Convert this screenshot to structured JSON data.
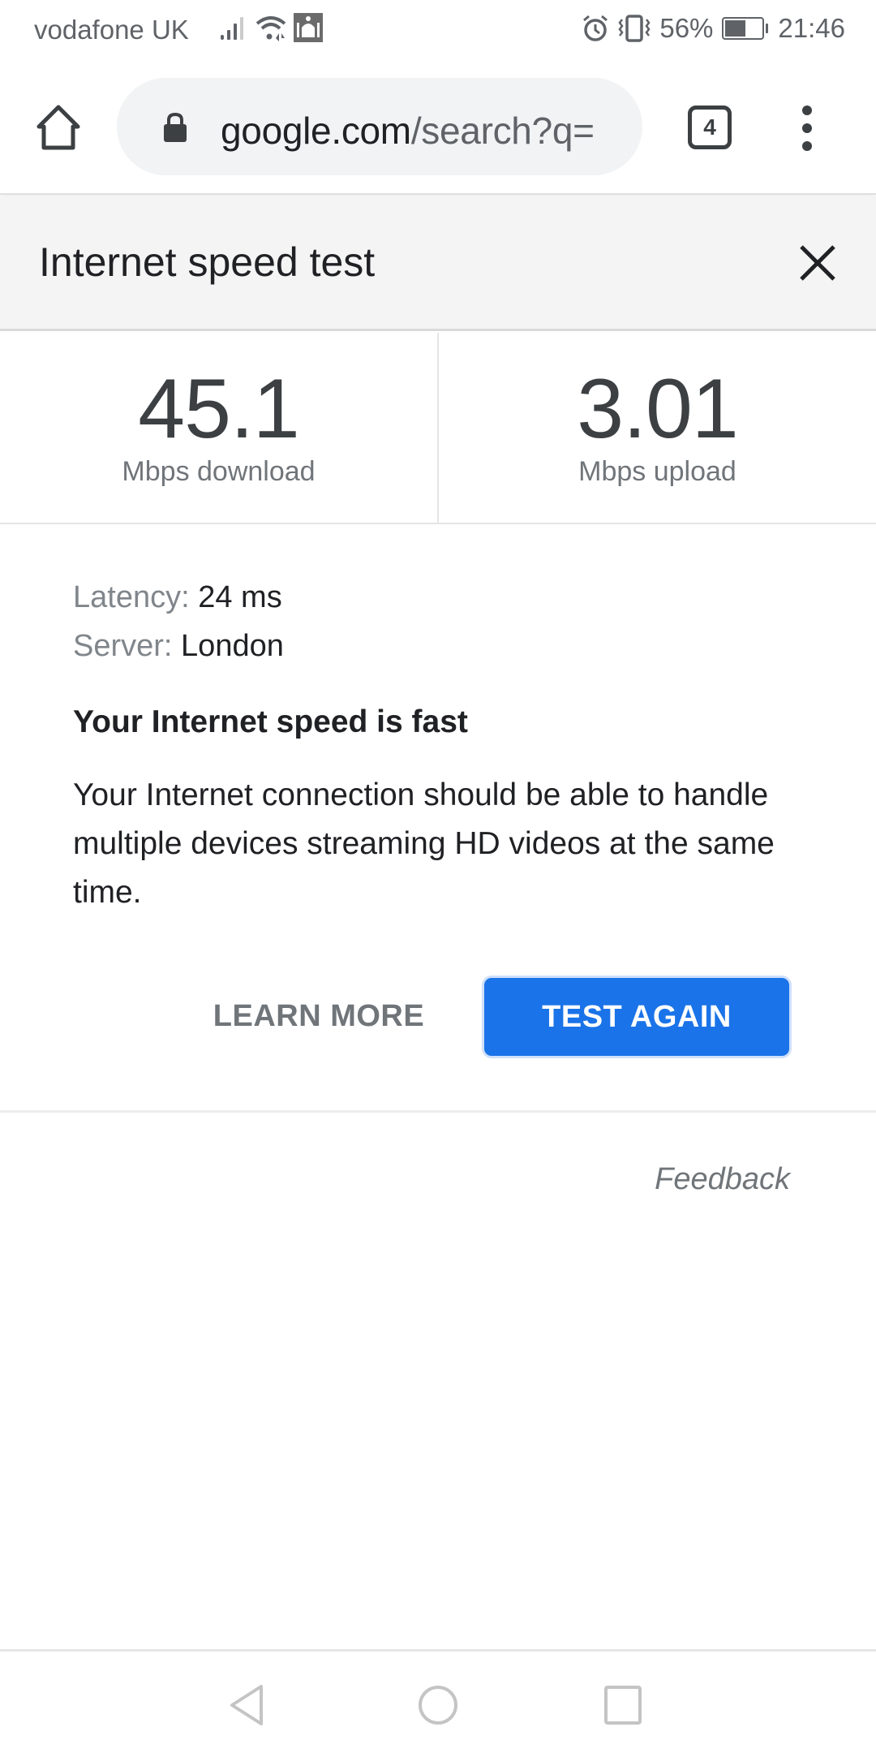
{
  "status_bar": {
    "carrier": "vodafone UK",
    "battery_percent": "56%",
    "battery_level": 0.56,
    "time": "21:46",
    "icons": [
      "signal-icon",
      "wifi-icon",
      "mosque-app-icon",
      "alarm-icon",
      "vibrate-icon",
      "battery-icon"
    ]
  },
  "browser": {
    "url_host": "google.com",
    "url_path": "/search?q=",
    "tab_count": "4",
    "icons": [
      "home-icon",
      "lock-icon",
      "tabs-icon",
      "more-vert-icon"
    ]
  },
  "card": {
    "title": "Internet speed test",
    "close_icon": "close-icon"
  },
  "results": {
    "download": {
      "value": "45.1",
      "unit": "Mbps download"
    },
    "upload": {
      "value": "3.01",
      "unit": "Mbps upload"
    }
  },
  "details": {
    "latency_label": "Latency:",
    "latency_value": "24 ms",
    "server_label": "Server:",
    "server_value": "London",
    "verdict": "Your Internet speed is fast",
    "description": "Your Internet connection should be able to handle multiple devices streaming HD videos at the same time."
  },
  "actions": {
    "learn_more": "LEARN MORE",
    "test_again": "TEST AGAIN",
    "accent_color": "#1a73e8"
  },
  "feedback": "Feedback",
  "nav_bar": {
    "icons": [
      "back-icon",
      "home-circle-icon",
      "recents-icon"
    ]
  }
}
